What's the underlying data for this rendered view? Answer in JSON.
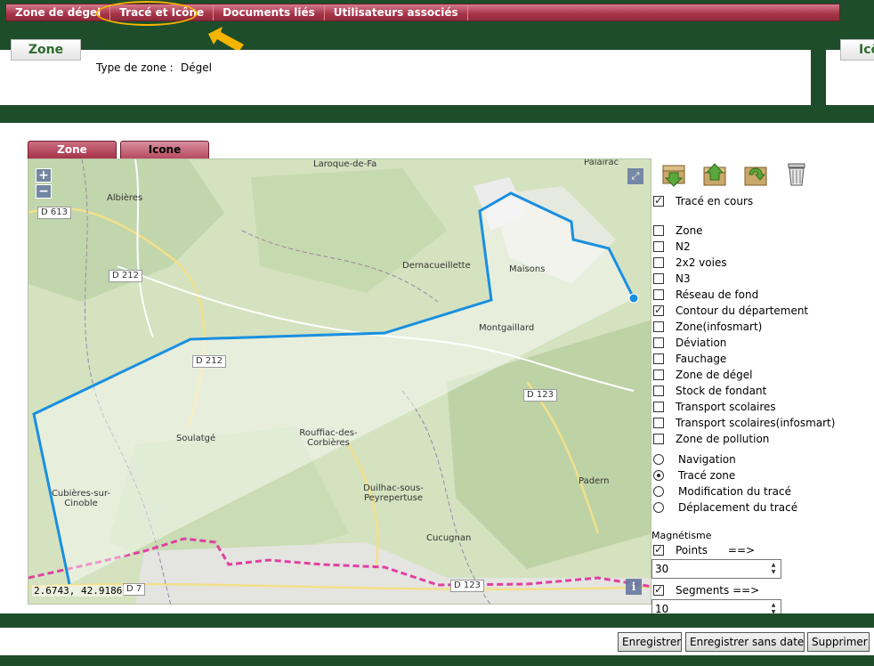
{
  "nav_tabs": [
    "Zone de dégel",
    "Tracé et Icône",
    "Documents liés",
    "Utilisateurs associés"
  ],
  "zone_panel": {
    "tab_label": "Zone",
    "type_label": "Type de zone :",
    "type_value": "Dégel"
  },
  "icone_panel": {
    "tab_label": "Icône"
  },
  "sub_tabs": {
    "zone": "Zone",
    "icone": "Icone"
  },
  "map": {
    "places": [
      "Laroque-de-Fa",
      "Albières",
      "Palairac",
      "Dernacueillette",
      "Maisons",
      "Montgaillard",
      "Rouffiac-des-Corbières",
      "Soulatgé",
      "Cubières-sur-Cinoble",
      "Duilhac-sous-Peyrepertuse",
      "Cucugnan",
      "Padern"
    ],
    "roads": [
      "D 613",
      "D 212",
      "D 212",
      "D 123",
      "D 7",
      "D 123"
    ],
    "coords": "2.6743, 42.9186",
    "zoom_in": "+",
    "zoom_out": "−",
    "info": "i",
    "fullscreen": "⤢"
  },
  "toolbar": {
    "icons": [
      "import-down-icon",
      "export-up-icon",
      "refresh-icon",
      "trash-icon"
    ]
  },
  "trace_en_cours": {
    "label": "Tracé en cours",
    "checked": true
  },
  "layers": [
    {
      "label": "Zone",
      "checked": false
    },
    {
      "label": "N2",
      "checked": false
    },
    {
      "label": "2x2 voies",
      "checked": false
    },
    {
      "label": "N3",
      "checked": false
    },
    {
      "label": "Réseau de fond",
      "checked": false
    },
    {
      "label": "Contour du département",
      "checked": true
    },
    {
      "label": "Zone(infosmart)",
      "checked": false
    },
    {
      "label": "Déviation",
      "checked": false
    },
    {
      "label": "Fauchage",
      "checked": false
    },
    {
      "label": "Zone de dégel",
      "checked": false
    },
    {
      "label": "Stock de fondant",
      "checked": false
    },
    {
      "label": "Transport scolaires",
      "checked": false
    },
    {
      "label": "Transport scolaires(infosmart)",
      "checked": false
    },
    {
      "label": "Zone de pollution",
      "checked": false
    }
  ],
  "modes": [
    {
      "label": "Navigation",
      "selected": false
    },
    {
      "label": "Tracé zone",
      "selected": true
    },
    {
      "label": "Modification du tracé",
      "selected": false
    },
    {
      "label": "Déplacement du tracé",
      "selected": false
    }
  ],
  "magnetisme": {
    "title": "Magnétisme",
    "points_label": "Points      ==>",
    "points_checked": true,
    "points_value": "30",
    "segments_label": "Segments ==>",
    "segments_checked": true,
    "segments_value": "10"
  },
  "buttons": {
    "save": "Enregistrer",
    "save_no_date": "Enregistrer sans date",
    "delete": "Supprimer"
  },
  "colors": {
    "band": "#1e4d2b",
    "tab": "#a63348",
    "trace": "#1a8fe0",
    "border_dept": "#e040a0",
    "highlight": "#f4b400"
  }
}
